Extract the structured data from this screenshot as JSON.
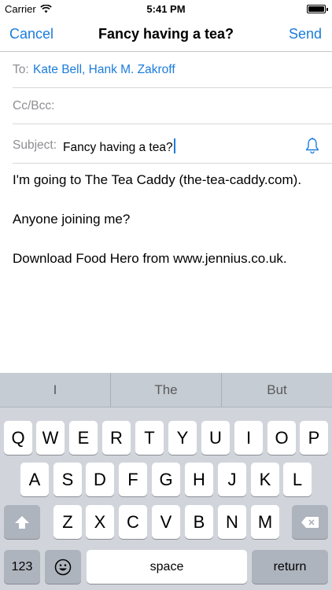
{
  "status_bar": {
    "carrier": "Carrier",
    "time": "5:41 PM"
  },
  "nav": {
    "cancel_label": "Cancel",
    "title": "Fancy having a tea?",
    "send_label": "Send"
  },
  "fields": {
    "to_label": "To:",
    "to_value": "Kate Bell, Hank M. Zakroff",
    "cc_label": "Cc/Bcc:",
    "subject_label": "Subject:",
    "subject_value": "Fancy having a tea?"
  },
  "body": {
    "line1": "I'm going to The Tea Caddy (the-tea-caddy.com).",
    "line2": "Anyone joining me?",
    "line3": "Download Food Hero from www.jennius.co.uk."
  },
  "keyboard": {
    "suggestions": [
      "I",
      "The",
      "But"
    ],
    "row1": [
      "Q",
      "W",
      "E",
      "R",
      "T",
      "Y",
      "U",
      "I",
      "O",
      "P"
    ],
    "row2": [
      "A",
      "S",
      "D",
      "F",
      "G",
      "H",
      "J",
      "K",
      "L"
    ],
    "row3": [
      "Z",
      "X",
      "C",
      "V",
      "B",
      "N",
      "M"
    ],
    "numbers_label": "123",
    "space_label": "space",
    "return_label": "return"
  },
  "colors": {
    "accent": "#1a7cdc",
    "keyboard_bg": "#d1d5db",
    "function_key": "#aeb4bd"
  }
}
